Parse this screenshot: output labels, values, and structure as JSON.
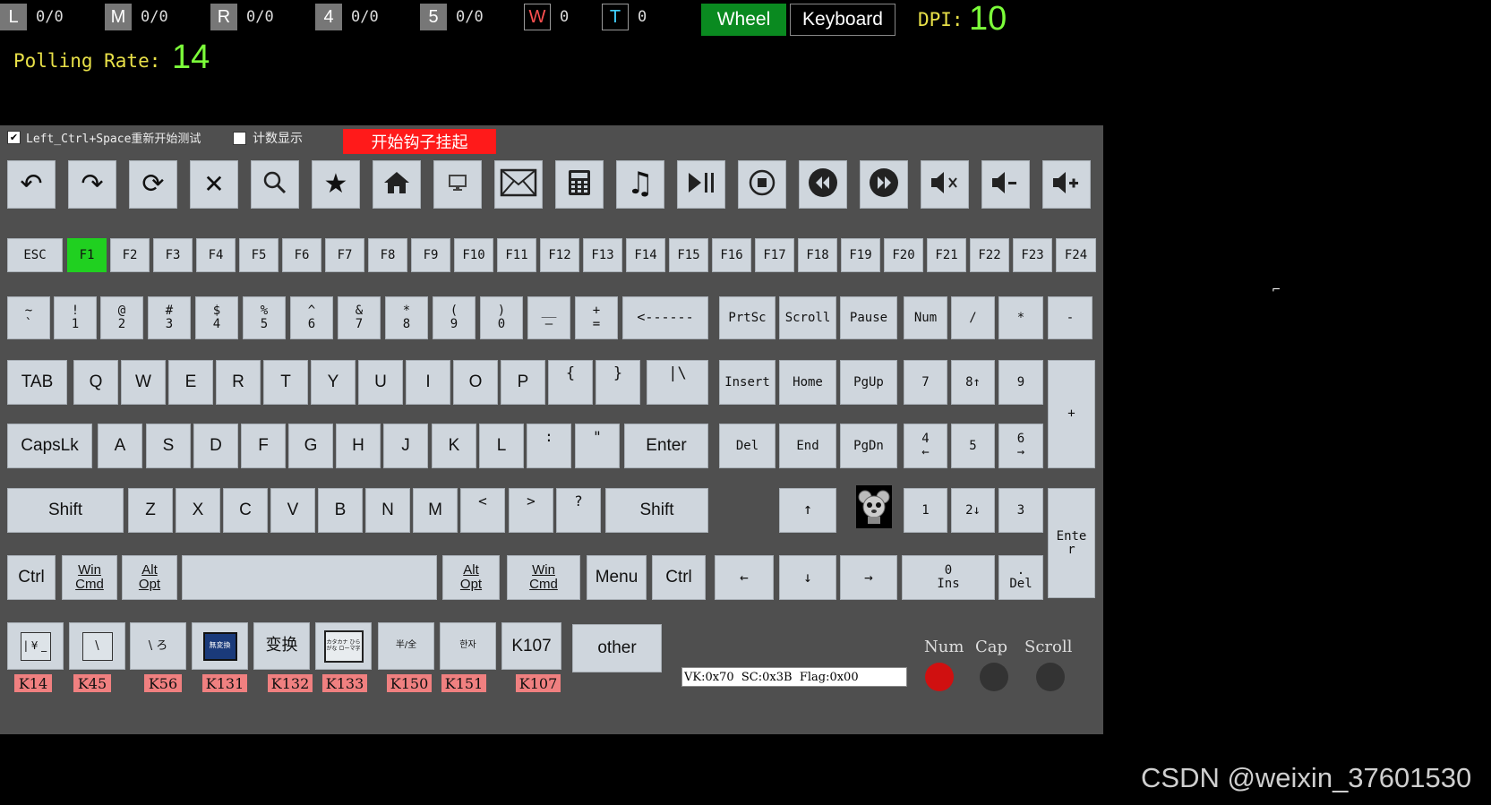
{
  "top": {
    "buttons": [
      {
        "label": "L",
        "count": "0/0"
      },
      {
        "label": "M",
        "count": "0/0"
      },
      {
        "label": "R",
        "count": "0/0"
      },
      {
        "label": "4",
        "count": "0/0"
      },
      {
        "label": "5",
        "count": "0/0"
      }
    ],
    "wheel_indicator": {
      "label": "W",
      "count": "0",
      "color": "#ff5050"
    },
    "tilt_indicator": {
      "label": "T",
      "count": "0",
      "color": "#40d0ff"
    },
    "wheel_tab": "Wheel",
    "keyboard_tab": "Keyboard",
    "dpi_label": "DPI:",
    "dpi_value": "10",
    "polling_label": "Polling Rate:",
    "polling_value": "14"
  },
  "options": {
    "restart_checkbox": "Left_Ctrl+Space重新开始测试",
    "count_checkbox": "计数显示",
    "hook_button": "开始钩子挂起"
  },
  "media_icons": [
    "back-icon",
    "forward-icon",
    "refresh-icon",
    "stop-icon",
    "search-icon",
    "favorites-icon",
    "home-icon",
    "computer-icon",
    "mail-icon",
    "calculator-icon",
    "music-icon",
    "play-pause-icon",
    "stop-media-icon",
    "previous-track-icon",
    "next-track-icon",
    "mute-icon",
    "volume-down-icon",
    "volume-up-icon"
  ],
  "fkeys": [
    "ESC",
    "F1",
    "F2",
    "F3",
    "F4",
    "F5",
    "F6",
    "F7",
    "F8",
    "F9",
    "F10",
    "F11",
    "F12",
    "F13",
    "F14",
    "F15",
    "F16",
    "F17",
    "F18",
    "F19",
    "F20",
    "F21",
    "F22",
    "F23",
    "F24"
  ],
  "number_row": [
    {
      "top": "~",
      "bottom": "`"
    },
    {
      "top": "!",
      "bottom": "1"
    },
    {
      "top": "@",
      "bottom": "2"
    },
    {
      "top": "#",
      "bottom": "3"
    },
    {
      "top": "$",
      "bottom": "4"
    },
    {
      "top": "%",
      "bottom": "5"
    },
    {
      "top": "^",
      "bottom": "6"
    },
    {
      "top": "&",
      "bottom": "7"
    },
    {
      "top": "*",
      "bottom": "8"
    },
    {
      "top": "(",
      "bottom": "9"
    },
    {
      "top": ")",
      "bottom": "0"
    },
    {
      "top": "__",
      "bottom": "—"
    },
    {
      "top": "+",
      "bottom": "="
    }
  ],
  "backspace": "<------",
  "nav_top": [
    "PrtSc",
    "Scroll",
    "Pause"
  ],
  "numpad_top": [
    "Num",
    "/",
    "*",
    "-"
  ],
  "row_q": [
    "TAB",
    "Q",
    "W",
    "E",
    "R",
    "T",
    "Y",
    "U",
    "I",
    "O",
    "P",
    "{",
    "}",
    "|\\"
  ],
  "row_q_nav": [
    "Insert",
    "Home",
    "PgUp"
  ],
  "numpad_789": [
    "7",
    "8↑",
    "9"
  ],
  "numpad_plus": "+",
  "row_a": [
    "CapsLk",
    "A",
    "S",
    "D",
    "F",
    "G",
    "H",
    "J",
    "K",
    "L",
    ":",
    "\"",
    "Enter"
  ],
  "row_a_nav": [
    "Del",
    "End",
    "PgDn"
  ],
  "numpad_456": [
    {
      "top": "4",
      "bottom": "←"
    },
    {
      "top": "5",
      "bottom": ""
    },
    {
      "top": "6",
      "bottom": "→"
    }
  ],
  "row_z": [
    "Shift",
    "Z",
    "X",
    "C",
    "V",
    "B",
    "N",
    "M",
    "<",
    ">",
    "?",
    "Shift"
  ],
  "arrow_up": "↑",
  "numpad_123": [
    "1",
    "2↓",
    "3"
  ],
  "numpad_enter": "Ente\nr",
  "row_ctrl": {
    "left_ctrl": "Ctrl",
    "left_win": [
      "Win",
      "Cmd"
    ],
    "left_alt": [
      "Alt",
      "Opt"
    ],
    "right_alt": [
      "Alt",
      "Opt"
    ],
    "right_win": [
      "Win",
      "Cmd"
    ],
    "menu": "Menu",
    "right_ctrl": "Ctrl"
  },
  "arrows": {
    "left": "←",
    "down": "↓",
    "right": "→"
  },
  "numpad_0": [
    "0",
    "Ins"
  ],
  "numpad_dot": [
    ".",
    "Del"
  ],
  "jp_keys": [
    {
      "face": "| ¥ _",
      "code": "K14"
    },
    {
      "face": "\\",
      "code": "K45"
    },
    {
      "face": "\\ ろ",
      "code": "K56"
    },
    {
      "face": "無変換",
      "code": "K131"
    },
    {
      "face": "变换",
      "code": "K132"
    },
    {
      "face": "カタカナ ひらがな ローマ字",
      "code": "K133"
    },
    {
      "face": "半/全",
      "code": "K150"
    },
    {
      "face": "한자",
      "code": "K151"
    },
    {
      "face": "K107",
      "code": "K107"
    }
  ],
  "other_button": "other",
  "vk_status": "VK:0x70  SC:0x3B  Flag:0x00",
  "leds": [
    {
      "label": "Num",
      "color": "#d01010"
    },
    {
      "label": "Cap",
      "color": "#333333"
    },
    {
      "label": "Scroll",
      "color": "#333333"
    }
  ],
  "watermark": "CSDN @weixin_37601530"
}
